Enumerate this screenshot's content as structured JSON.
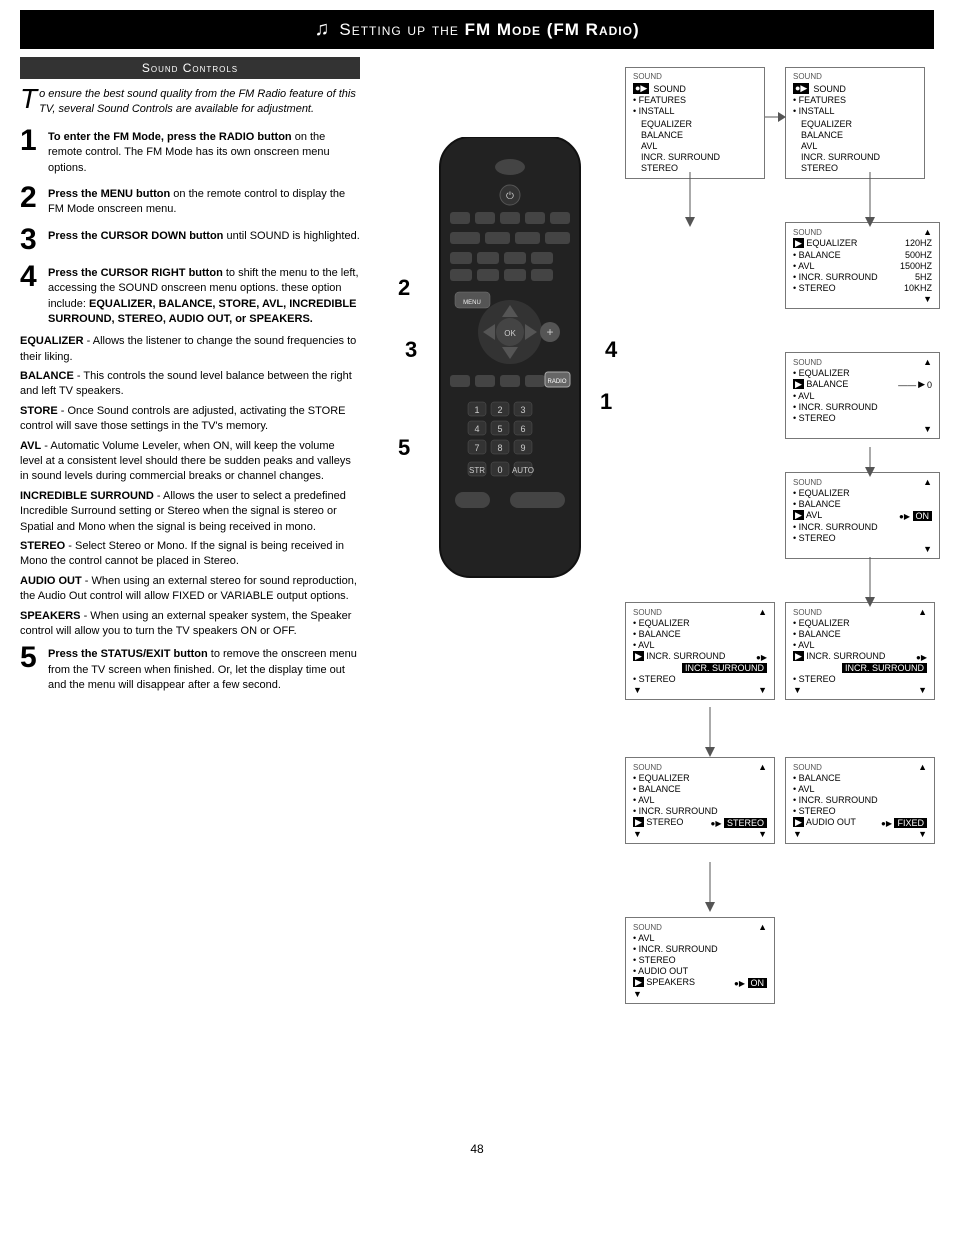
{
  "header": {
    "title": "Setting up the FM Mode (FM Radio)",
    "music_icon": "♫"
  },
  "section": {
    "heading": "Sound Controls"
  },
  "intro": {
    "text": "o ensure the best sound quality from the FM Radio feature of this TV, several Sound Controls are available for adjustment.",
    "drop_cap": "T"
  },
  "steps": [
    {
      "number": "1",
      "text": "To enter the FM Mode, press the RADIO button on the remote control. The FM Mode has its own onscreen menu options."
    },
    {
      "number": "2",
      "text": "Press the MENU button on the remote control to display the FM Mode onscreen menu."
    },
    {
      "number": "3",
      "text": "Press the CURSOR DOWN button until SOUND is highlighted."
    },
    {
      "number": "4",
      "text": "Press the CURSOR RIGHT button to shift the menu to the left, accessing the SOUND onscreen menu options. these option include: EQUALIZER, BALANCE, STORE, AVL, INCREDIBLE SURROUND, STEREO, AUDIO OUT, or SPEAKERS."
    },
    {
      "number": "5",
      "text": "Press the STATUS/EXIT button to remove the onscreen menu from the TV screen when finished. Or, let the display time out and the menu will disappear after a few second."
    }
  ],
  "terms": [
    {
      "name": "EQUALIZER",
      "definition": "- Allows the listener to change the sound frequencies to their liking."
    },
    {
      "name": "BALANCE",
      "definition": "- This controls the sound level balance between the right and left TV speakers."
    },
    {
      "name": "STORE",
      "definition": "- Once Sound controls are adjusted, activating the STORE control will save those settings in the TV's memory."
    },
    {
      "name": "AVL",
      "definition": "- Automatic Volume Leveler, when ON, will keep the volume level at a consistent level should there be sudden peaks and valleys in sound levels during commercial breaks or channel changes."
    },
    {
      "name": "INCREDIBLE SURROUND",
      "definition": "- Allows the user to select a predefined Incredible Surround setting or Stereo when the signal is stereo or Spatial and Mono when the signal is being received in mono."
    },
    {
      "name": "STEREO",
      "definition": "- Select Stereo or Mono. If the signal is being received in Mono the control cannot be placed in Stereo."
    },
    {
      "name": "AUDIO OUT",
      "definition": "- When using an external stereo for sound reproduction, the Audio Out control will allow FIXED or VARIABLE output options."
    },
    {
      "name": "SPEAKERS",
      "definition": "- When using an external speaker system, the Speaker control will allow you to turn the TV speakers ON or OFF."
    }
  ],
  "panels": {
    "panel1": {
      "title": "SOUND",
      "items": [
        "● SOUND",
        "• FEATURES",
        "• INSTALL"
      ],
      "sub_items": [
        "EQUALIZER",
        "BALANCE",
        "AVL",
        "INCR. SURROUND",
        "STEREO"
      ]
    },
    "panel2": {
      "title": "SOUND",
      "items": [
        "●▶ SOUND",
        "• FEATURES",
        "• INSTALL"
      ],
      "sub_items": [
        "EQUALIZER",
        "BALANCE",
        "AVL",
        "INCR. SURROUND",
        "STEREO"
      ]
    },
    "panel3": {
      "title": "SOUND",
      "items": [
        "▶ EQUALIZER",
        "• BALANCE",
        "• AVL",
        "• INCR. SURROUND",
        "• STEREO"
      ],
      "values": [
        "120HZ",
        "500HZ",
        "1500HZ",
        "5HZ",
        "10KHZ"
      ],
      "selected": "EQUALIZER"
    },
    "panel4": {
      "title": "SOUND",
      "items": [
        "• EQUALIZER",
        "▶ BALANCE",
        "• AVL",
        "• INCR. SURROUND",
        "• STEREO"
      ],
      "balance_value": "0",
      "selected": "BALANCE"
    },
    "panel5": {
      "title": "SOUND",
      "items": [
        "• EQUALIZER",
        "• BALANCE",
        "▶ AVL",
        "• INCR. SURROUND",
        "• STEREO"
      ],
      "avl_value": "ON",
      "selected": "AVL"
    },
    "panel6a": {
      "title": "SOUND",
      "items": [
        "• EQUALIZER",
        "• BALANCE",
        "• AVL",
        "▶ INCR. SURROUND",
        "• STEREO"
      ],
      "incr_value": "INCR. SURROUND",
      "selected": "INCR. SURROUND"
    },
    "panel6b": {
      "title": "SOUND",
      "items": [
        "• EQUALIZER",
        "• BALANCE",
        "• AVL",
        "▶ INCR. SURROUND",
        "• STEREO"
      ],
      "incr_value": "INCR. SURROUND",
      "selected": "INCR. SURROUND"
    },
    "panel7a": {
      "title": "SOUND",
      "items": [
        "• EQUALIZER",
        "• BALANCE",
        "• AVL",
        "• INCR. SURROUND",
        "▶ STEREO"
      ],
      "stereo_value": "STEREO",
      "selected": "STEREO"
    },
    "panel7b": {
      "title": "SOUND",
      "items": [
        "• BALANCE",
        "• AVL",
        "• INCR. SURROUND",
        "• STEREO",
        "▶ AUDIO OUT"
      ],
      "audio_value": "FIXED",
      "selected": "AUDIO OUT"
    },
    "panel8": {
      "title": "SOUND",
      "items": [
        "• AVL",
        "• INCR. SURROUND",
        "• STEREO",
        "• AUDIO OUT",
        "▶ SPEAKERS"
      ],
      "speakers_value": "ON",
      "selected": "SPEAKERS"
    }
  },
  "page_number": "48"
}
